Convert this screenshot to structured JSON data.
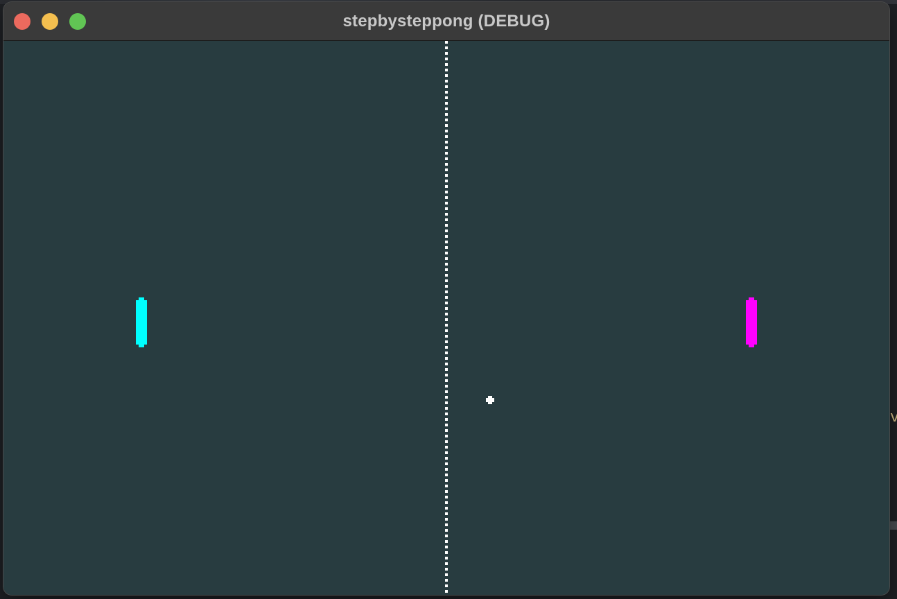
{
  "window": {
    "title": "stepbysteppong (DEBUG)",
    "controls": {
      "close_color": "#ec6a5e",
      "minimize_color": "#f4bf4f",
      "zoom_color": "#61c554"
    }
  },
  "game": {
    "background_color": "#283c40",
    "net_color": "#ffffff",
    "left_paddle": {
      "color": "#00ffff"
    },
    "right_paddle": {
      "color": "#ff00ff"
    },
    "ball": {
      "color": "#ffffff"
    }
  },
  "background": {
    "edge_text": "vr"
  }
}
